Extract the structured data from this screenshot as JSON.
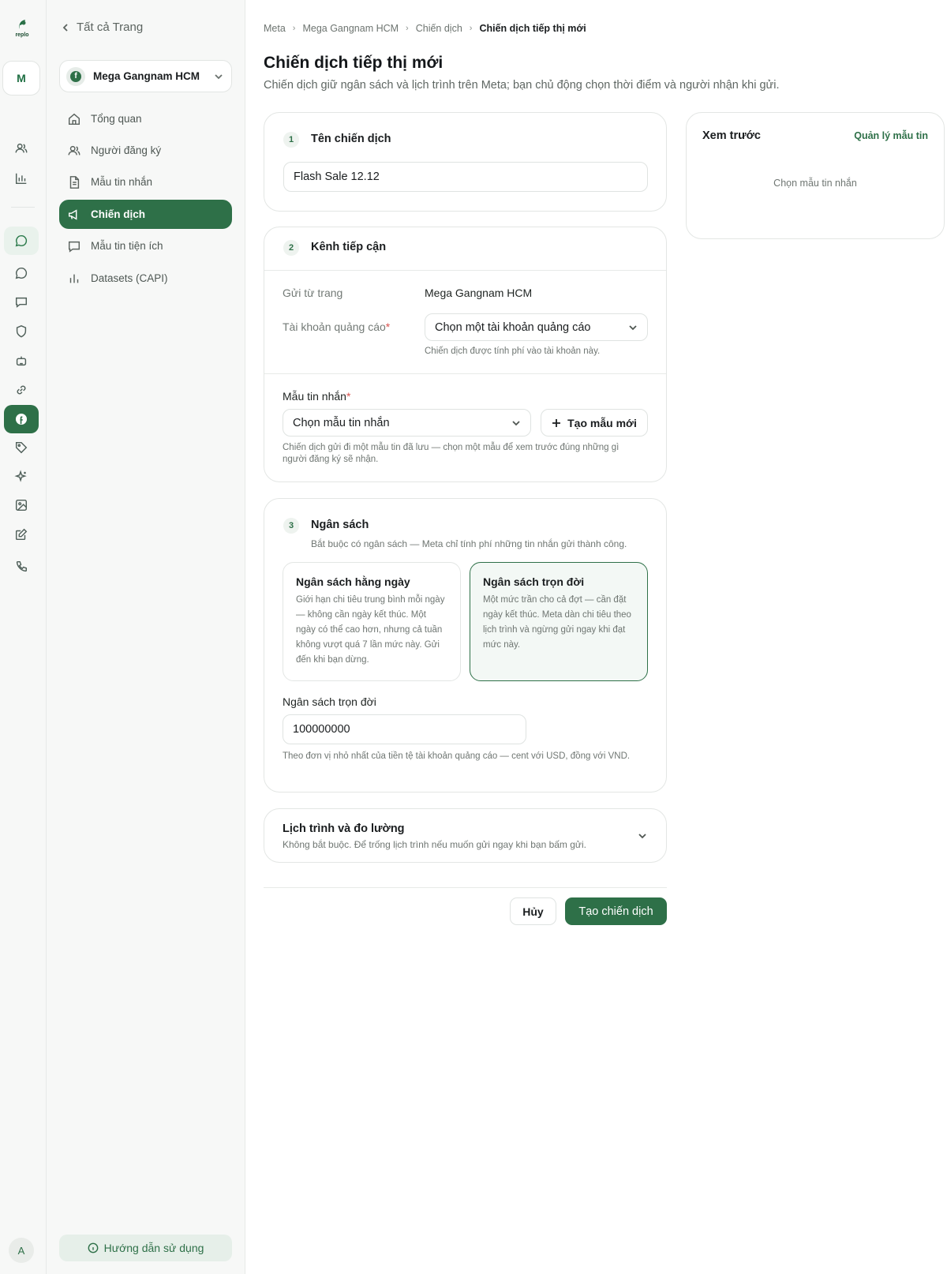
{
  "rail": {
    "logo_text": "replo",
    "workspace_initial": "M",
    "avatar_initial": "A"
  },
  "nav": {
    "back_label": "Tất cả Trang",
    "page_name": "Mega Gangnam HCM",
    "items": [
      {
        "label": "Tổng quan",
        "icon": "home-icon"
      },
      {
        "label": "Người đăng ký",
        "icon": "users-icon"
      },
      {
        "label": "Mẫu tin nhắn",
        "icon": "document-icon"
      },
      {
        "label": "Chiến dịch",
        "icon": "megaphone-icon",
        "active": true
      },
      {
        "label": "Mẫu tin tiện ích",
        "icon": "message-icon"
      },
      {
        "label": "Datasets (CAPI)",
        "icon": "bar-chart-icon"
      }
    ],
    "help_label": "Hướng dẫn sử dụng"
  },
  "breadcrumb": [
    "Meta",
    "Mega Gangnam HCM",
    "Chiến dịch",
    "Chiến dịch tiếp thị mới"
  ],
  "page": {
    "title": "Chiến dịch tiếp thị mới",
    "subtitle": "Chiến dịch giữ ngân sách và lịch trình trên Meta; bạn chủ động chọn thời điểm và người nhận khi gửi."
  },
  "section1": {
    "number": "1",
    "title": "Tên chiến dịch",
    "value": "Flash Sale 12.12"
  },
  "section2": {
    "number": "2",
    "title": "Kênh tiếp cận",
    "from_page_label": "Gửi từ trang",
    "from_page_value": "Mega Gangnam HCM",
    "ad_account_label": "Tài khoản quảng cáo",
    "ad_account_placeholder": "Chọn một tài khoản quảng cáo",
    "ad_account_hint": "Chiến dịch được tính phí vào tài khoản này.",
    "template_label": "Mẫu tin nhắn",
    "template_placeholder": "Chọn mẫu tin nhắn",
    "new_template_label": "Tạo mẫu mới",
    "template_hint": "Chiến dịch gửi đi một mẫu tin đã lưu — chọn một mẫu để xem trước đúng những gì người đăng ký sẽ nhận."
  },
  "section3": {
    "number": "3",
    "title": "Ngân sách",
    "subtitle": "Bắt buộc có ngân sách — Meta chỉ tính phí những tin nhắn gửi thành công.",
    "daily_title": "Ngân sách hằng ngày",
    "daily_desc": "Giới hạn chi tiêu trung bình mỗi ngày — không cần ngày kết thúc. Một ngày có thể cao hơn, nhưng cả tuần không vượt quá 7 lần mức này. Gửi đến khi bạn dừng.",
    "lifetime_title": "Ngân sách trọn đời",
    "lifetime_desc": "Một mức trần cho cả đợt — cần đặt ngày kết thúc. Meta dàn chi tiêu theo lịch trình và ngừng gửi ngay khi đạt mức này.",
    "selected": "lifetime",
    "amount_label": "Ngân sách trọn đời",
    "amount_value": "100000000",
    "amount_hint": "Theo đơn vị nhỏ nhất của tiền tệ tài khoản quảng cáo — cent với USD, đồng với VND."
  },
  "section4": {
    "title": "Lịch trình và đo lường",
    "subtitle": "Không bắt buộc. Để trống lịch trình nếu muốn gửi ngay khi bạn bấm gửi."
  },
  "preview": {
    "title": "Xem trước",
    "manage_link": "Quản lý mẫu tin",
    "empty_text": "Chọn mẫu tin nhắn"
  },
  "actions": {
    "cancel_label": "Hủy",
    "create_label": "Tạo chiến dịch"
  },
  "colors": {
    "accent": "#2e7048",
    "required": "#d9534f"
  }
}
